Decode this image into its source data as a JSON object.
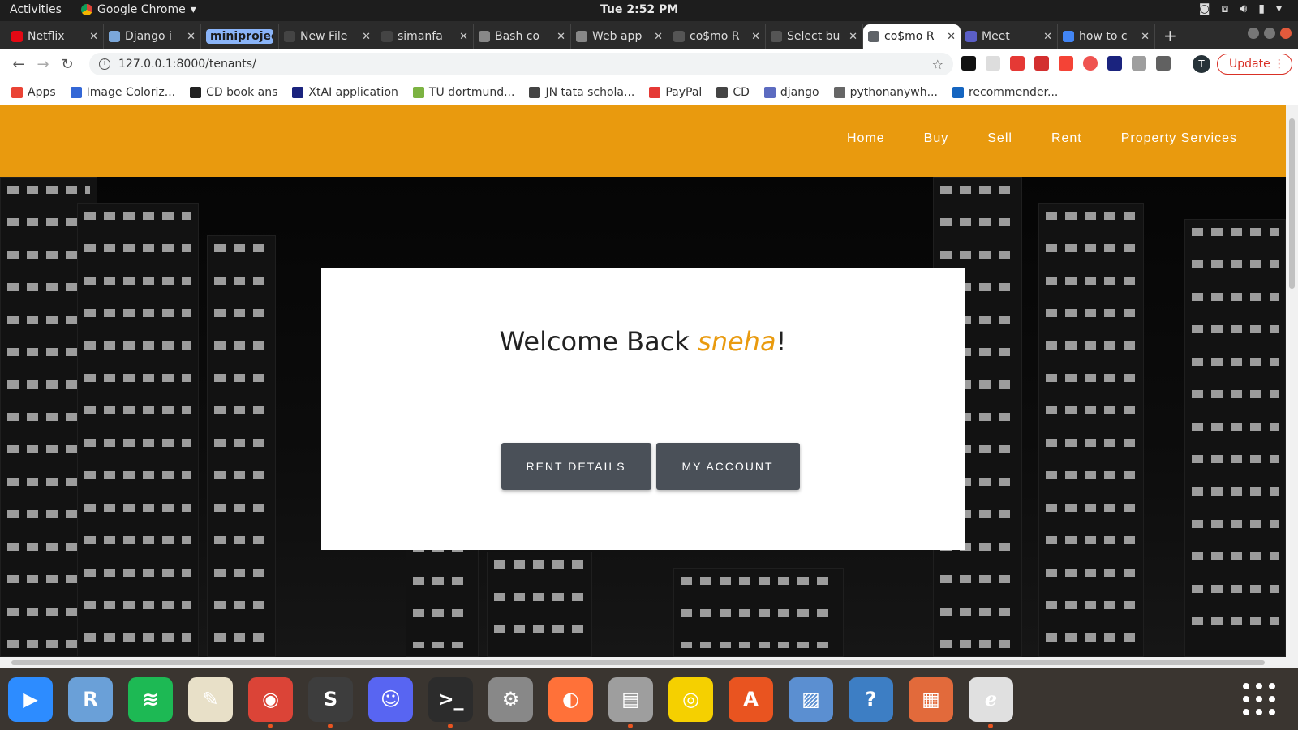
{
  "system": {
    "activities": "Activities",
    "app_name": "Google Chrome",
    "clock": "Tue  2:52 PM"
  },
  "tabs": [
    {
      "label": "Netflix",
      "color": "#e50914"
    },
    {
      "label": "Django i",
      "color": "#7ba7d9"
    },
    {
      "label": "miniproject",
      "group": true
    },
    {
      "label": "New File",
      "color": "#444444"
    },
    {
      "label": "simanfa",
      "color": "#444444"
    },
    {
      "label": "Bash co",
      "color": "#888888"
    },
    {
      "label": "Web app",
      "color": "#888888"
    },
    {
      "label": "co$mo R",
      "color": "#555555"
    },
    {
      "label": "Select bu",
      "color": "#555555"
    },
    {
      "label": "co$mo R",
      "color": "#5f6368",
      "active": true
    },
    {
      "label": "Meet",
      "color": "#5b5fc7"
    },
    {
      "label": "how to c",
      "color": "#4285f4"
    }
  ],
  "address_bar": {
    "url": "127.0.0.1:8000/tenants/",
    "profile_initial": "T",
    "update_label": "Update",
    "menu_glyph": "⋮"
  },
  "bookmarks": [
    {
      "label": "Apps",
      "color": "#ea4335"
    },
    {
      "label": "Image Coloriz...",
      "color": "#3367d6"
    },
    {
      "label": "CD book ans",
      "color": "#222222"
    },
    {
      "label": "XtAI application",
      "color": "#1a237e"
    },
    {
      "label": "TU dortmund...",
      "color": "#7cb342"
    },
    {
      "label": "JN tata schola...",
      "color": "#444444"
    },
    {
      "label": "PayPal",
      "color": "#e53935"
    },
    {
      "label": "CD",
      "color": "#444444"
    },
    {
      "label": "django",
      "color": "#5c6bc0"
    },
    {
      "label": "pythonanywh...",
      "color": "#666666"
    },
    {
      "label": "recommender...",
      "color": "#1565c0"
    }
  ],
  "site": {
    "nav": [
      "Home",
      "Buy",
      "Sell",
      "Rent",
      "Property Services"
    ],
    "welcome_prefix": "Welcome Back ",
    "username": "sneha",
    "welcome_suffix": "!",
    "buttons": {
      "rent_details": "RENT DETAILS",
      "my_account": "MY ACCOUNT"
    },
    "accent_color": "#e99a0e",
    "button_color": "#4a5058"
  },
  "dock": [
    {
      "name": "zoom-icon",
      "color": "#2d8cff",
      "glyph": "▶"
    },
    {
      "name": "r-icon",
      "color": "#6aa0d8",
      "glyph": "R"
    },
    {
      "name": "spotify-icon",
      "color": "#1db954",
      "glyph": "≋"
    },
    {
      "name": "text-editor-icon",
      "color": "#e8e0c8",
      "glyph": "✎"
    },
    {
      "name": "chrome-icon",
      "color": "#db4437",
      "glyph": "◉",
      "running": true,
      "focused": true
    },
    {
      "name": "sublime-icon",
      "color": "#3d3d3d",
      "glyph": "S",
      "running": true
    },
    {
      "name": "discord-icon",
      "color": "#5865f2",
      "glyph": "☺"
    },
    {
      "name": "terminal-icon",
      "color": "#2c2c2c",
      "glyph": ">_",
      "running": true
    },
    {
      "name": "settings-icon",
      "color": "#888888",
      "glyph": "⚙"
    },
    {
      "name": "firefox-icon",
      "color": "#ff7139",
      "glyph": "◐"
    },
    {
      "name": "files-icon",
      "color": "#9e9e9e",
      "glyph": "▤",
      "running": true
    },
    {
      "name": "rhythmbox-icon",
      "color": "#f5d000",
      "glyph": "◎"
    },
    {
      "name": "software-icon",
      "color": "#e95420",
      "glyph": "A"
    },
    {
      "name": "image-viewer-icon",
      "color": "#5b8fd1",
      "glyph": "▨"
    },
    {
      "name": "help-icon",
      "color": "#3d7ec4",
      "glyph": "?"
    },
    {
      "name": "presentation-icon",
      "color": "#e26a3b",
      "glyph": "▦"
    },
    {
      "name": "pdf-icon",
      "color": "#e0e0e0",
      "glyph": "ℯ",
      "running": true
    }
  ]
}
